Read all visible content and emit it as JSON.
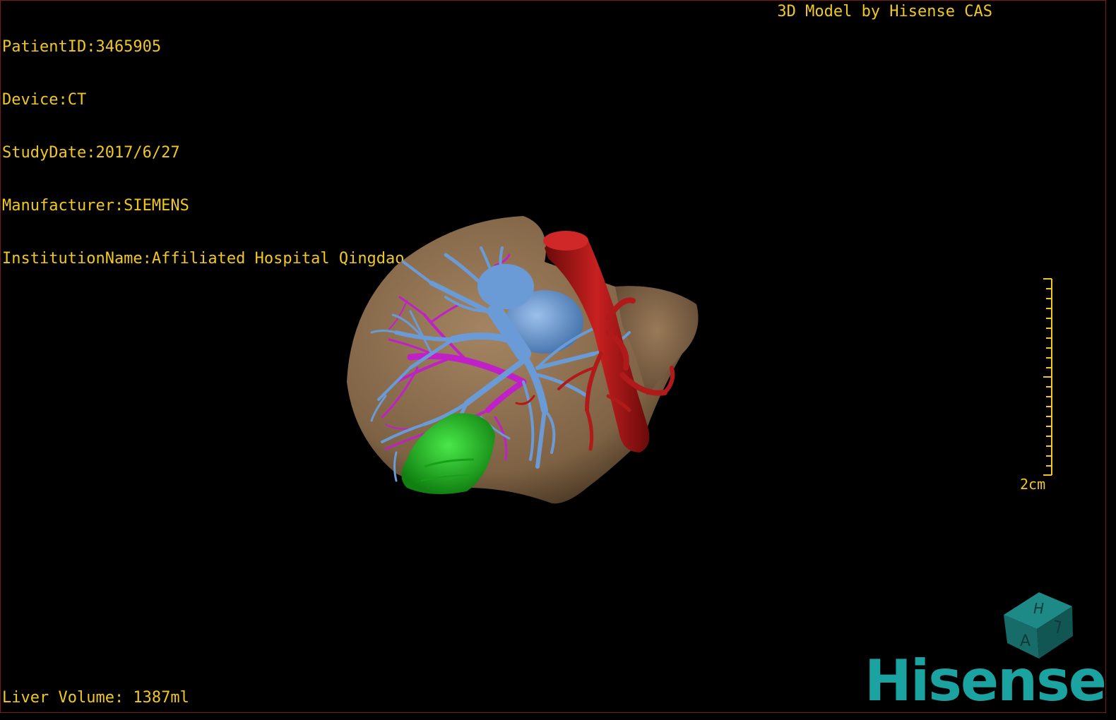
{
  "overlay": {
    "patient_id": "PatientID:3465905",
    "device": "Device:CT",
    "study_date": "StudyDate:2017/6/27",
    "manufacturer": "Manufacturer:SIEMENS",
    "institution": "InstitutionName:Affiliated Hospital Qingdao University-C",
    "caption": "3D Model by Hisense CAS",
    "liver_volume": "Liver Volume: 1387ml"
  },
  "scale_bar": {
    "label": "2cm"
  },
  "orientation_cube": {
    "faces": [
      "H",
      "A"
    ],
    "icon": "orientation-cube-icon"
  },
  "logo": {
    "text": "Hisense"
  },
  "colors": {
    "overlay_text": "#f0c820",
    "liver": "#8a6e4e",
    "portal_vein": "#6a9bd6",
    "hepatic_vessels": "#c020c8",
    "aorta": "#b01a1a",
    "tumor": "#20c020",
    "brand": "#1aa3a0"
  }
}
